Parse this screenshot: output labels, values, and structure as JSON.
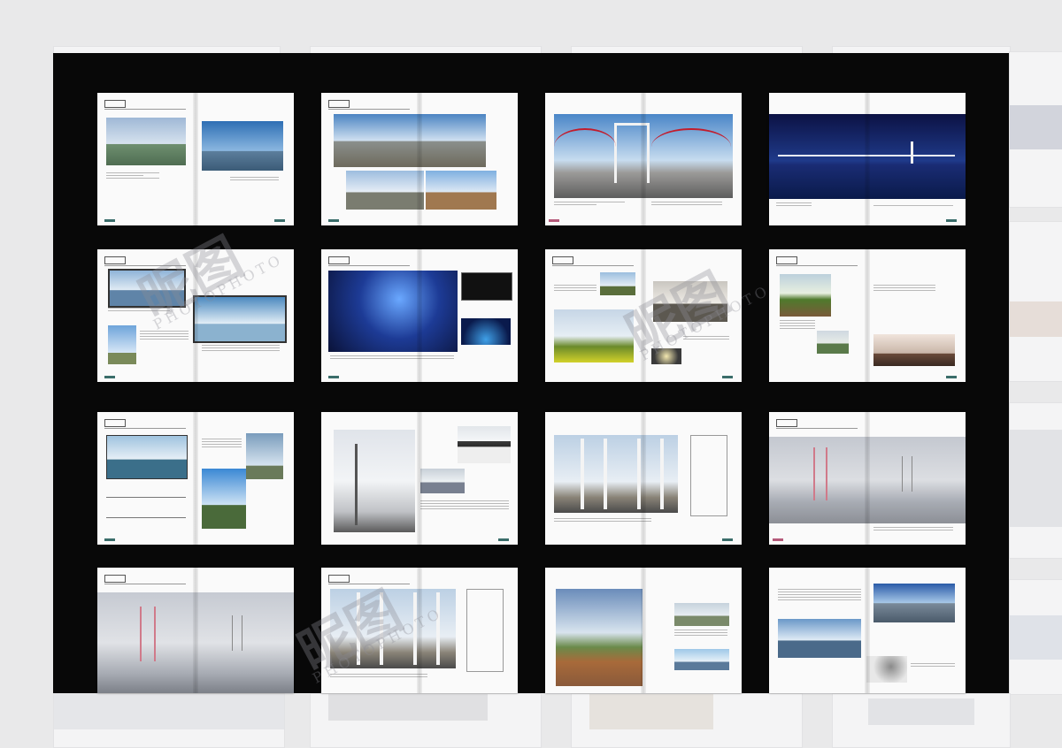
{
  "watermark": {
    "mark": "昵图",
    "latin": "PHOTOPHOTO"
  },
  "colors": {
    "board": "#080808",
    "sky": "#5f8fc4",
    "night": "#1b2b6b",
    "fog": "#d4d6dc",
    "accent": "#3a6d6a"
  },
  "spreads": [
    {
      "id": "s1",
      "theme": "day"
    },
    {
      "id": "s2",
      "theme": "panorama"
    },
    {
      "id": "s3",
      "theme": "red-bridge"
    },
    {
      "id": "s4",
      "theme": "night"
    },
    {
      "id": "s5",
      "theme": "day"
    },
    {
      "id": "s6",
      "theme": "night-blue"
    },
    {
      "id": "s7",
      "theme": "collage"
    },
    {
      "id": "s8",
      "theme": "sunset"
    },
    {
      "id": "s9",
      "theme": "day"
    },
    {
      "id": "s10",
      "theme": "cable"
    },
    {
      "id": "s11",
      "theme": "pylon"
    },
    {
      "id": "s12",
      "theme": "fog"
    },
    {
      "id": "s13",
      "theme": "fog"
    },
    {
      "id": "s14",
      "theme": "pylon"
    },
    {
      "id": "s15",
      "theme": "river"
    },
    {
      "id": "s16",
      "theme": "collage"
    }
  ]
}
